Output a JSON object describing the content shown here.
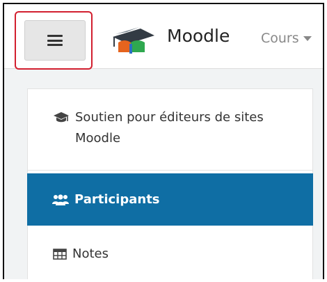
{
  "navbar": {
    "brand": "Moodle",
    "menu_cours": "Cours",
    "icons": {
      "menu_toggle": "hamburger-icon",
      "logo": "moodle-hat-logo",
      "dropdown": "caret-down-icon"
    }
  },
  "nav": {
    "items": [
      {
        "label": "Soutien pour éditeurs de sites Moodle",
        "icon": "graduation-cap-icon",
        "active": false
      },
      {
        "label": "Participants",
        "icon": "users-icon",
        "active": true
      },
      {
        "label": "Notes",
        "icon": "table-icon",
        "active": false
      }
    ]
  },
  "colors": {
    "active_bg": "#0f6ea4",
    "highlight_border": "#d21f2f"
  }
}
